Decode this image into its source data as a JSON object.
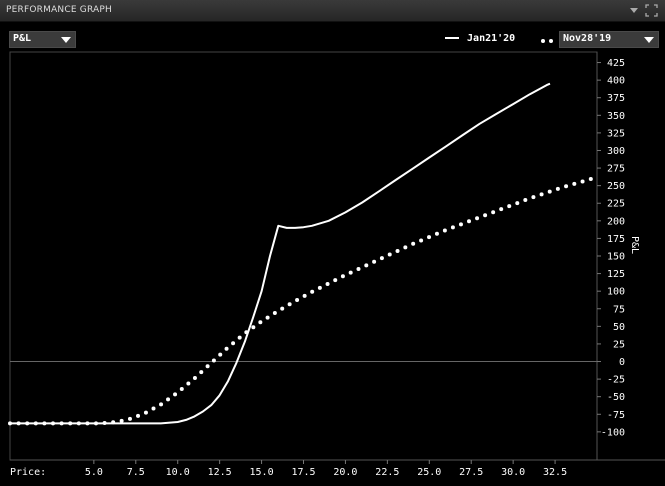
{
  "window": {
    "title": "PERFORMANCE GRAPH"
  },
  "toolbar": {
    "metric_select": "P&L",
    "legend_solid": "Jan21'20",
    "date_select": "Nov28'19"
  },
  "chart_data": {
    "type": "line",
    "ylabel": "P&L",
    "xlabel": "Price:",
    "xlim": [
      0,
      35
    ],
    "ylim": [
      -140,
      440
    ],
    "x_ticks": [
      "5.0",
      "7.5",
      "10.0",
      "12.5",
      "15.0",
      "17.5",
      "20.0",
      "22.5",
      "25.0",
      "27.5",
      "30.0",
      "32.5"
    ],
    "x_tick_values": [
      5,
      7.5,
      10,
      12.5,
      15,
      17.5,
      20,
      22.5,
      25,
      27.5,
      30,
      32.5
    ],
    "y_ticks": [
      425,
      400,
      375,
      350,
      325,
      300,
      275,
      250,
      225,
      200,
      175,
      150,
      125,
      100,
      75,
      50,
      25,
      0,
      -25,
      -50,
      -75,
      -100
    ],
    "series": [
      {
        "name": "Jan21'20",
        "style": "solid",
        "color": "#ffffff",
        "x": [
          0,
          5,
          9,
          10,
          10.5,
          11,
          11.5,
          12,
          12.5,
          13,
          13.5,
          14,
          14.5,
          15,
          15.5,
          16,
          16.5,
          17,
          17.5,
          18,
          19,
          20,
          21,
          22,
          23,
          24,
          25,
          26,
          27,
          28,
          29,
          30,
          31,
          32,
          32.2
        ],
        "y": [
          -88,
          -88,
          -88,
          -86,
          -83,
          -78,
          -71,
          -62,
          -48,
          -28,
          -2,
          28,
          63,
          100,
          150,
          193,
          190,
          190,
          191,
          193,
          200,
          212,
          226,
          242,
          258,
          274,
          290,
          306,
          322,
          338,
          352,
          366,
          380,
          393,
          395
        ]
      },
      {
        "name": "Nov28'19",
        "style": "dotted",
        "color": "#ffffff",
        "x": [
          0,
          5,
          6,
          7,
          8,
          9,
          10,
          11,
          12,
          13,
          14,
          15,
          16,
          17,
          18,
          19,
          20,
          21,
          22,
          23,
          24,
          25,
          26,
          27,
          28,
          29,
          30,
          31,
          32,
          33,
          34,
          35
        ],
        "y": [
          -88,
          -88,
          -87,
          -83,
          -74,
          -61,
          -44,
          -24,
          -2,
          20,
          40,
          57,
          72,
          86,
          99,
          111,
          123,
          134,
          145,
          156,
          167,
          177,
          187,
          196,
          205,
          214,
          223,
          232,
          240,
          248,
          255,
          262
        ]
      }
    ],
    "zero_line": true
  }
}
